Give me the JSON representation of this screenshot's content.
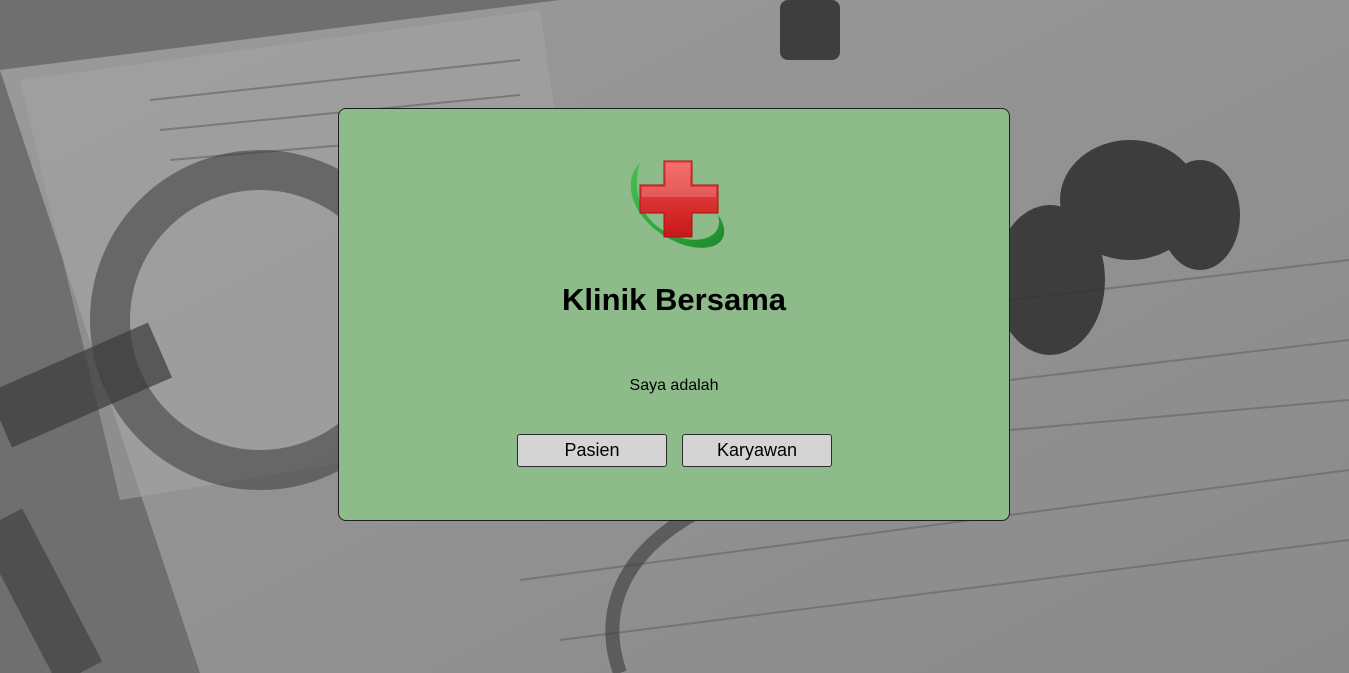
{
  "app": {
    "title": "Klinik Bersama",
    "prompt": "Saya adalah"
  },
  "buttons": {
    "patient_label": "Pasien",
    "employee_label": "Karyawan"
  },
  "logo": {
    "icon": "medical-cross-icon",
    "cross_color": "#e02828",
    "ring_color": "#2ea83a"
  },
  "colors": {
    "card_background": "#8dbb8a",
    "page_background": "#7d7d7d",
    "button_background": "#d4d4d4"
  }
}
